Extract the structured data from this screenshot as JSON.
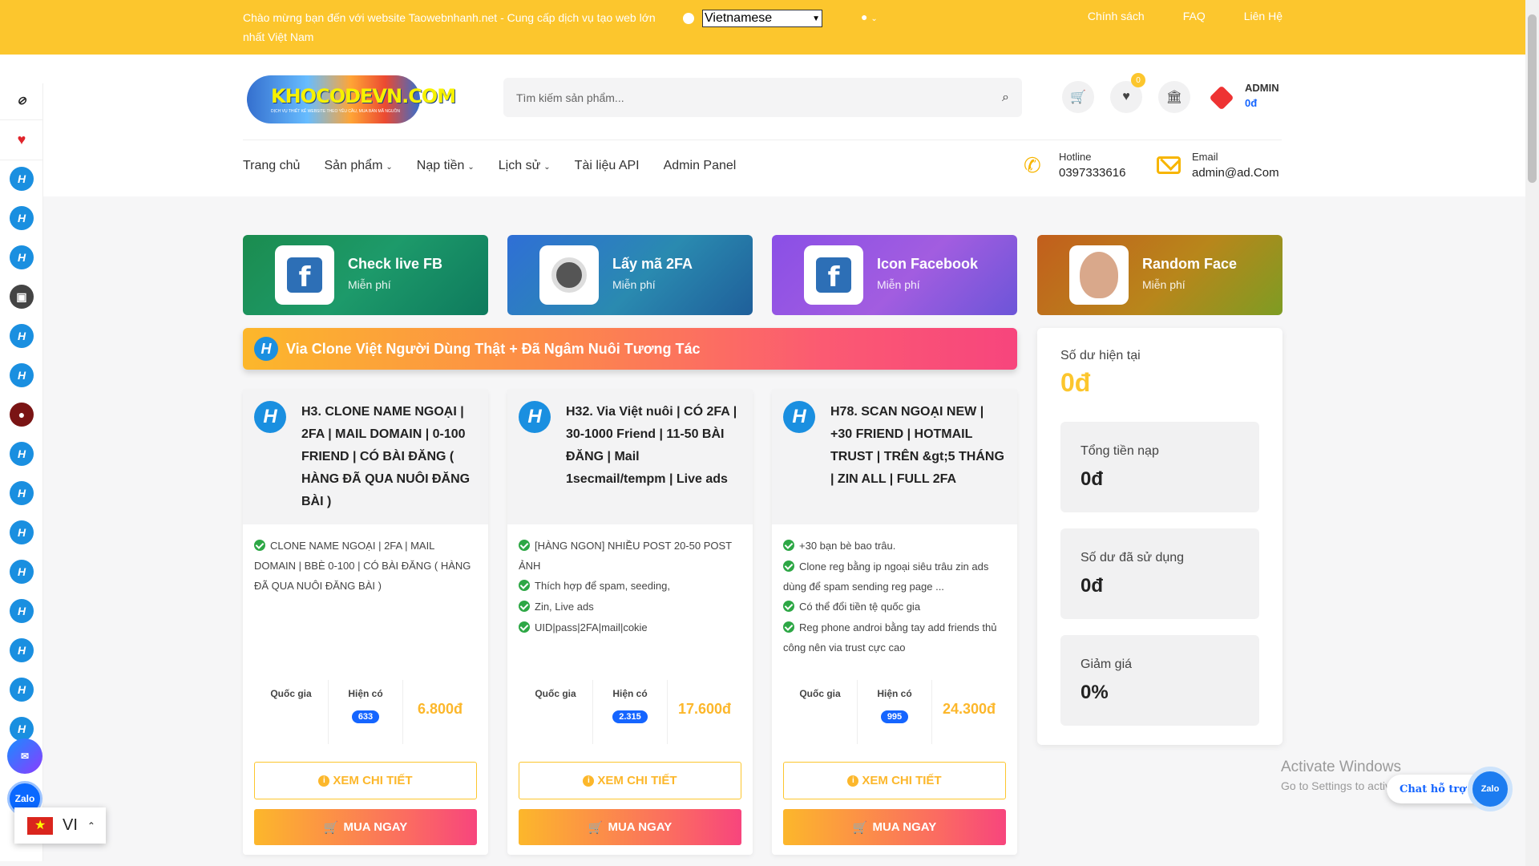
{
  "topbar": {
    "welcome": "Chào mừng bạn đến với website Taowebnhanh.net - Cung cấp dịch vụ tạo web lớn nhất Việt Nam",
    "language": "Vietnamese",
    "links": [
      "Chính sách",
      "FAQ",
      "Liên Hệ"
    ]
  },
  "header": {
    "logo_text": "KHOCODEVN.COM",
    "logo_sub": "DỊCH VỤ THIẾT KẾ WEBSITE THEO YÊU CẦU, MUA BÁN MÃ NGUỒN",
    "search_placeholder": "Tìm kiếm sản phẩm...",
    "wishlist_count": "0",
    "user_name": "ADMIN",
    "user_balance": "0đ",
    "nav": [
      "Trang chủ",
      "Sản phẩm",
      "Nạp tiền",
      "Lịch sử",
      "Tài liệu API",
      "Admin Panel"
    ],
    "hotline_label": "Hotline",
    "hotline_value": "0397333616",
    "email_label": "Email",
    "email_value": "admin@ad.Com"
  },
  "tiles": [
    {
      "title": "Check live FB",
      "sub": "Miễn phí"
    },
    {
      "title": "Lấy mã 2FA",
      "sub": "Miễn phí"
    },
    {
      "title": "Icon Facebook",
      "sub": "Miễn phí"
    },
    {
      "title": "Random Face",
      "sub": "Miễn phí"
    }
  ],
  "banner": "Via Clone Việt Người Dùng Thật + Đã Ngâm Nuôi Tương Tác",
  "products": [
    {
      "title": "H3. CLONE NAME NGOẠI | 2FA | MAIL DOMAIN | 0-100 FRIEND | CÓ BÀI ĐĂNG ( HÀNG ĐÃ QUA NUÔI ĐĂNG BÀI )",
      "features": [
        "CLONE NAME NGOẠI | 2FA | MAIL DOMAIN | BBÈ 0-100 | CÓ BÀI ĐĂNG ( HÀNG ĐÃ QUA NUÔI ĐĂNG BÀI )"
      ],
      "country_label": "Quốc gia",
      "stock_label": "Hiện có",
      "stock": "633",
      "price": "6.800đ",
      "detail_label": "XEM CHI TIẾT",
      "buy_label": "MUA NGAY"
    },
    {
      "title": "H32. Via Việt nuôi | CÓ 2FA | 30-1000 Friend | 11-50 BÀI ĐĂNG | Mail 1secmail/tempm | Live ads",
      "features": [
        "[HÀNG NGON] NHIỀU POST 20-50 POST ẢNH",
        "Thích hợp để spam, seeding,",
        "Zin, Live ads",
        "UID|pass|2FA|mail|cokie"
      ],
      "country_label": "Quốc gia",
      "stock_label": "Hiện có",
      "stock": "2.315",
      "price": "17.600đ",
      "detail_label": "XEM CHI TIẾT",
      "buy_label": "MUA NGAY"
    },
    {
      "title": "H78. SCAN NGOẠI NEW | +30 FRIEND | HOTMAIL TRUST | TRÊN &gt;5 THÁNG | ZIN ALL | FULL 2FA",
      "features": [
        "+30 bạn bè bao trâu.",
        "Clone reg bằng ip ngoại siêu trâu zin ads dùng để spam sending reg page ...",
        "Có thể đổi tiền tệ quốc gia",
        "Reg phone androi bằng tay add friends thủ công nên via trust cực cao"
      ],
      "country_label": "Quốc gia",
      "stock_label": "Hiện có",
      "stock": "995",
      "price": "24.300đ",
      "detail_label": "XEM CHI TIẾT",
      "buy_label": "MUA NGAY"
    }
  ],
  "balance": {
    "current_label": "Số dư hiện tại",
    "current_value": "0đ",
    "boxes": [
      {
        "label": "Tổng tiền nạp",
        "value": "0đ"
      },
      {
        "label": "Số dư đã sử dụng",
        "value": "0đ"
      },
      {
        "label": "Giảm giá",
        "value": "0%"
      }
    ]
  },
  "floating": {
    "lang_code": "VI",
    "zalo": "Zalo",
    "chat_label": "Chat hỗ trợ",
    "activate_title": "Activate Windows",
    "activate_sub": "Go to Settings to activate Windows."
  },
  "colors": {
    "accent": "#fcc62d",
    "link_blue": "#1565ff",
    "price": "#fcb72b"
  }
}
